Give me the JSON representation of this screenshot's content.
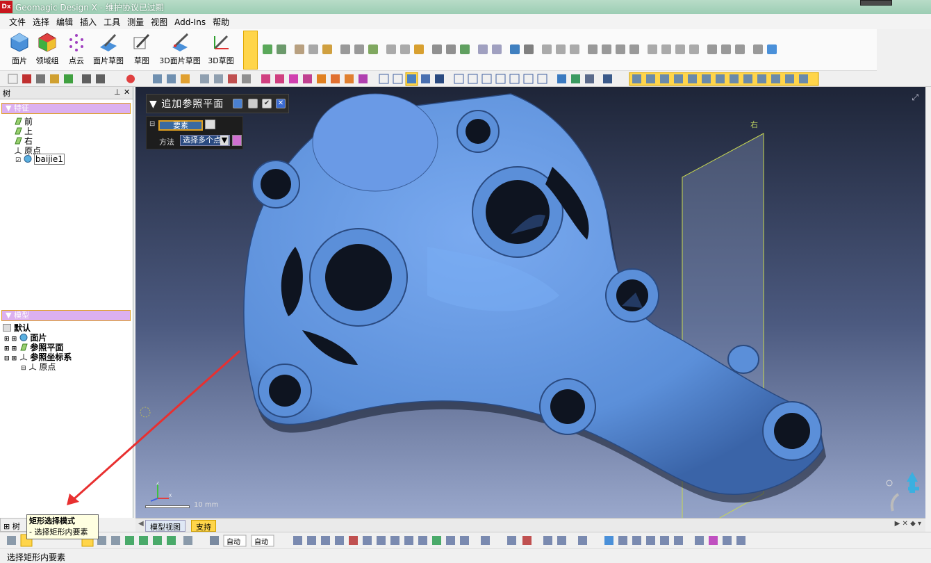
{
  "window": {
    "app_icon": "Dx",
    "title": "Geomagic Design X - 维护协议已过期"
  },
  "menu": [
    "文件",
    "选择",
    "编辑",
    "插入",
    "工具",
    "测量",
    "视图",
    "Add-Ins",
    "帮助"
  ],
  "ribbon": {
    "buttons": [
      "面片",
      "领域组",
      "点云",
      "面片草图",
      "草图",
      "3D面片草图",
      "3D草图"
    ]
  },
  "tree_panel": {
    "title": "树",
    "features_header": "特征",
    "features": [
      "前",
      "上",
      "右",
      "原点",
      "baijie1"
    ],
    "model_header": "模型",
    "model_items": [
      "默认",
      "面片",
      "参照平面",
      "参照坐标系",
      "原点"
    ]
  },
  "dialog": {
    "title": "追加参照平面",
    "element_label": "要素",
    "method_label": "方法",
    "method_value": "选择多个点"
  },
  "viewport": {
    "plane_label": "右",
    "scale_label": "10 mm",
    "background_top": "#1e2538",
    "background_bottom": "#9aa8cc",
    "mesh_color": "#5b8fd9"
  },
  "view_tabs": [
    "模型视图",
    "支持"
  ],
  "tree_tab": "树",
  "tooltip": {
    "title": "矩形选择模式",
    "desc": "- 选择矩形内要素"
  },
  "status": "选择矩形内要素",
  "toolbar_selects": [
    "自动",
    "自动"
  ]
}
